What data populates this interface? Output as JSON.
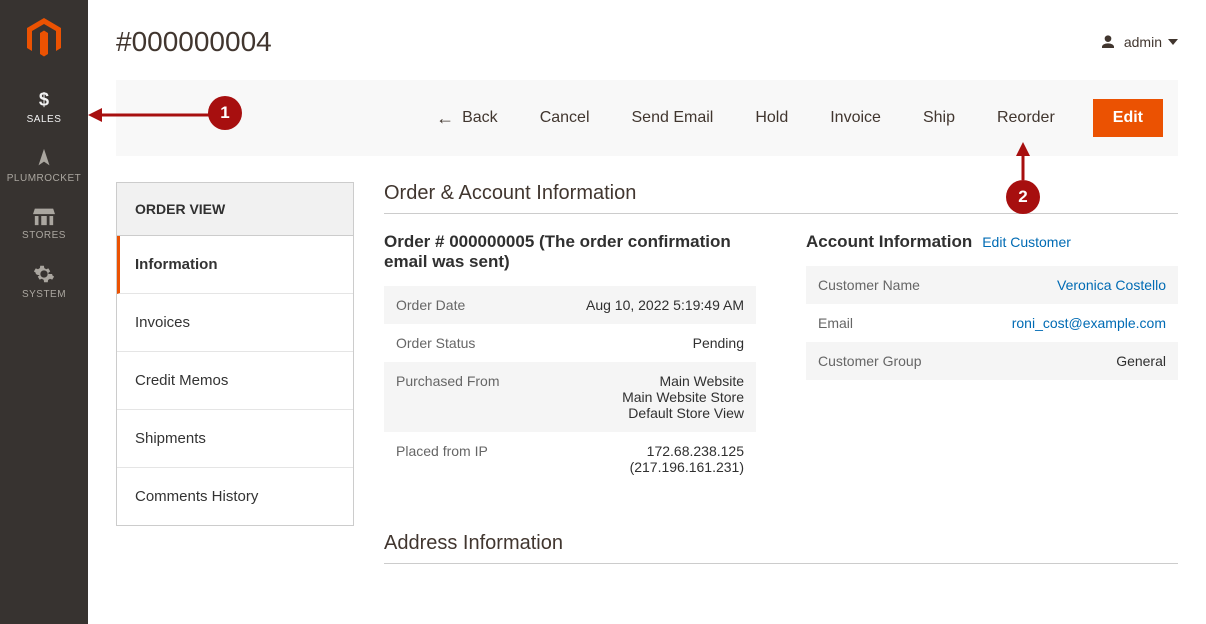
{
  "brand_color": "#eb5202",
  "nav": {
    "items": [
      {
        "id": "sales",
        "label": "SALES"
      },
      {
        "id": "plumrocket",
        "label": "PLUMROCKET"
      },
      {
        "id": "stores",
        "label": "STORES"
      },
      {
        "id": "system",
        "label": "SYSTEM"
      }
    ]
  },
  "header": {
    "title": "#000000004",
    "user_label": "admin"
  },
  "actions": {
    "back": "Back",
    "cancel": "Cancel",
    "send_email": "Send Email",
    "hold": "Hold",
    "invoice": "Invoice",
    "ship": "Ship",
    "reorder": "Reorder",
    "edit": "Edit"
  },
  "order_view": {
    "panel_title": "ORDER VIEW",
    "tabs": [
      "Information",
      "Invoices",
      "Credit Memos",
      "Shipments",
      "Comments History"
    ]
  },
  "sections": {
    "main_title": "Order & Account Information",
    "address_title": "Address Information"
  },
  "order": {
    "heading": "Order # 000000005 (The order confirmation email was sent)",
    "rows": {
      "date_label": "Order Date",
      "date_value": "Aug 10, 2022 5:19:49 AM",
      "status_label": "Order Status",
      "status_value": "Pending",
      "from_label": "Purchased From",
      "from_value_l1": "Main Website",
      "from_value_l2": "Main Website Store",
      "from_value_l3": "Default Store View",
      "ip_label": "Placed from IP",
      "ip_value_l1": "172.68.238.125",
      "ip_value_l2": "(217.196.161.231)"
    }
  },
  "account": {
    "heading": "Account Information",
    "edit_link": "Edit Customer",
    "rows": {
      "name_label": "Customer Name",
      "name_value": "Veronica Costello",
      "email_label": "Email",
      "email_value": "roni_cost@example.com",
      "group_label": "Customer Group",
      "group_value": "General"
    }
  },
  "callouts": {
    "one": "1",
    "two": "2"
  }
}
